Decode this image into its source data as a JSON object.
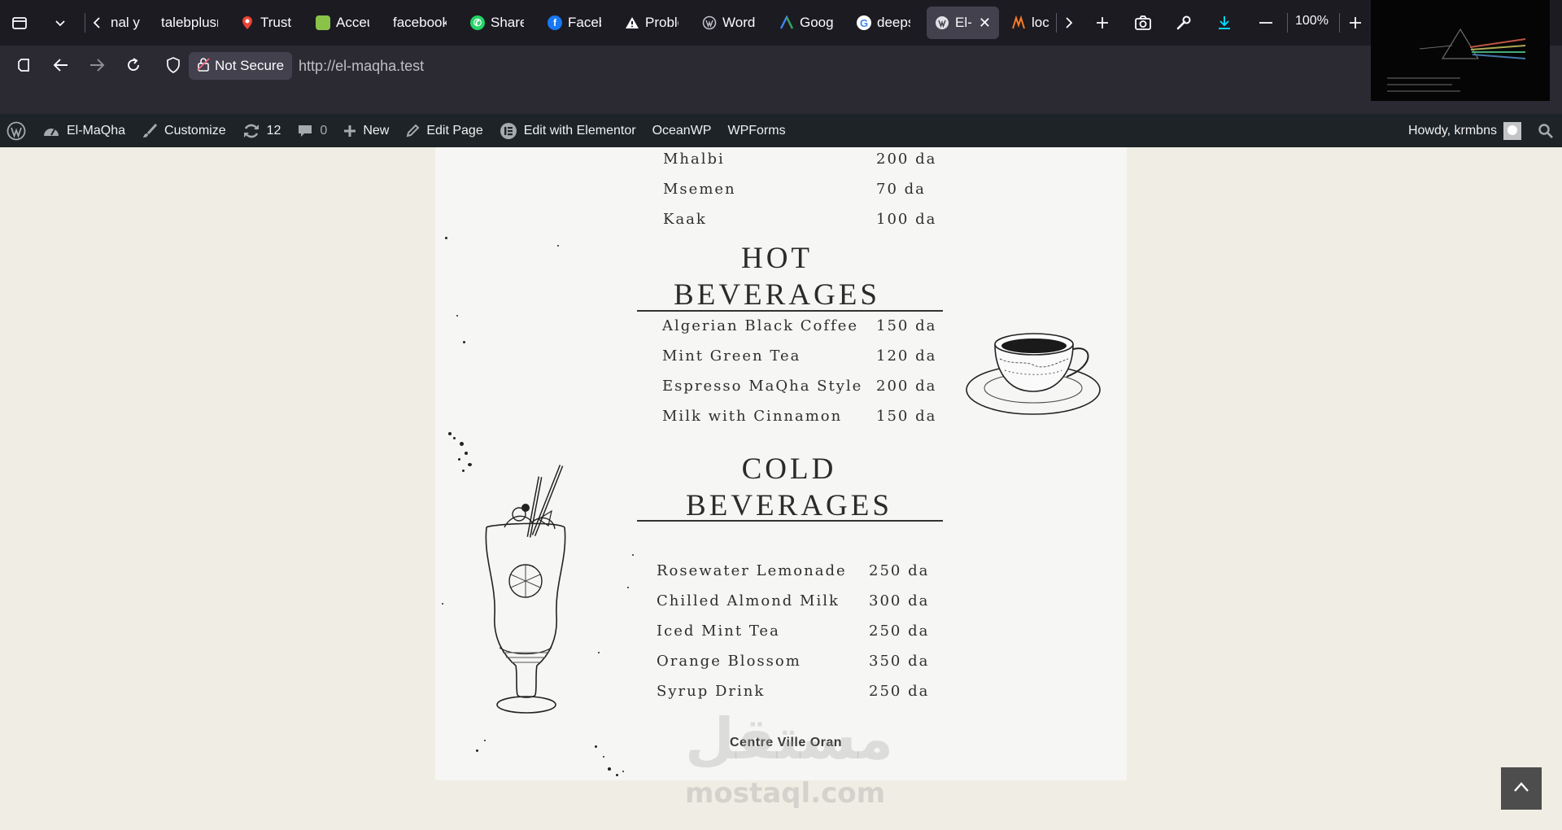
{
  "browser": {
    "tabs": [
      {
        "label": "nal y",
        "favicon": ""
      },
      {
        "label": "talebplusn",
        "favicon": ""
      },
      {
        "label": "Trust l",
        "favicon": "map-pin-icon"
      },
      {
        "label": "Acceu",
        "favicon": "green-square-icon"
      },
      {
        "label": "facebook.c",
        "favicon": ""
      },
      {
        "label": "Share",
        "favicon": "whatsapp-icon"
      },
      {
        "label": "Facebo",
        "favicon": "facebook-icon"
      },
      {
        "label": "Proble",
        "favicon": "warning-icon"
      },
      {
        "label": "WordP",
        "favicon": "wordpress-icon"
      },
      {
        "label": "Googl",
        "favicon": "google-a-icon"
      },
      {
        "label": "deeps",
        "favicon": "google-icon"
      },
      {
        "label": "El-M",
        "favicon": "wordpress-icon",
        "active": true
      },
      {
        "label": "loca",
        "favicon": "xampp-icon"
      }
    ],
    "zoom": "100%",
    "security_label": "Not Secure",
    "url": "http://el-maqha.test"
  },
  "admin_bar": {
    "site_name": "El-MaQha",
    "customize": "Customize",
    "updates_count": "12",
    "comments_count": "0",
    "new": "New",
    "edit_page": "Edit Page",
    "edit_elementor": "Edit with Elementor",
    "oceanwp": "OceanWP",
    "wpforms": "WPForms",
    "howdy": "Howdy, krmbns"
  },
  "menu": {
    "pastries": [
      {
        "name": "Mhalbi",
        "price": "200 da"
      },
      {
        "name": "Msemen",
        "price": "70 da"
      },
      {
        "name": "Kaak",
        "price": "100 da"
      }
    ],
    "hot_title_1": "HOT",
    "hot_title_2": "BEVERAGES",
    "hot": [
      {
        "name": "Algerian Black Coffee",
        "price": "150 da"
      },
      {
        "name": "Mint Green Tea",
        "price": "120 da"
      },
      {
        "name": "Espresso MaQha Style",
        "price": "200 da"
      },
      {
        "name": "Milk with Cinnamon",
        "price": "150 da"
      }
    ],
    "cold_title_1": "COLD",
    "cold_title_2": "BEVERAGES",
    "cold": [
      {
        "name": "Rosewater Lemonade",
        "price": "250 da"
      },
      {
        "name": "Chilled Almond Milk",
        "price": "300 da"
      },
      {
        "name": "Iced Mint Tea",
        "price": "250 da"
      },
      {
        "name": "Orange Blossom",
        "price": "350 da"
      },
      {
        "name": "Syrup Drink",
        "price": "250 da"
      }
    ],
    "address": "Centre Ville Oran"
  },
  "watermark": {
    "arabic": "مستقل",
    "latin": "mostaql.com"
  },
  "colors": {
    "tabbar": "#1c1b22",
    "urlbar": "#2b2a33",
    "adminbar": "#1d2327",
    "page_bg": "#f0ede4",
    "card_bg": "#f6f6f4"
  }
}
